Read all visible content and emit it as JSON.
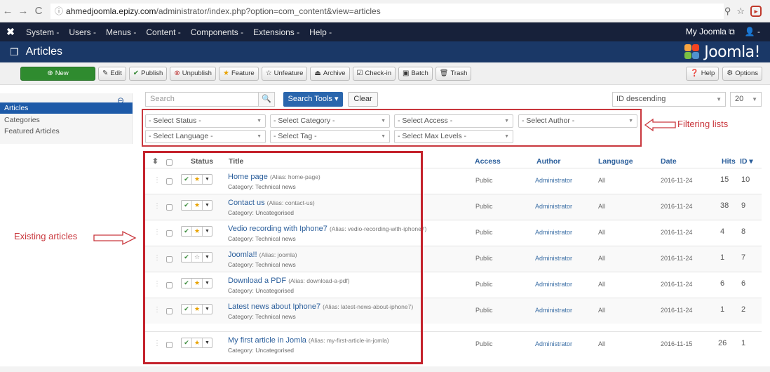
{
  "browser": {
    "url_prefix": "ahmedjoomla.epizy.com",
    "url_rest": "/administrator/index.php?option=com_content&view=articles",
    "info": "ⓘ"
  },
  "topnav": {
    "items": [
      "System -",
      "Users -",
      "Menus -",
      "Content -",
      "Components -",
      "Extensions -",
      "Help -"
    ],
    "my_joomla": "My Joomla ⧉",
    "user": "👤 -"
  },
  "header": {
    "title": "Articles",
    "brand": "Joomla!"
  },
  "toolbar": {
    "new": "New",
    "edit": "Edit",
    "publish": "Publish",
    "unpublish": "Unpublish",
    "feature": "Feature",
    "unfeature": "Unfeature",
    "archive": "Archive",
    "checkin": "Check-in",
    "batch": "Batch",
    "trash": "Trash",
    "help": "Help",
    "options": "Options"
  },
  "sidebar": {
    "items": [
      "Articles",
      "Categories",
      "Featured Articles"
    ]
  },
  "search": {
    "placeholder": "Search",
    "tools": "Search Tools ▾",
    "clear": "Clear",
    "ordering": "ID descending",
    "limit": "20"
  },
  "filters": {
    "status": "- Select Status -",
    "category": "- Select Category -",
    "access": "- Select Access -",
    "author": "- Select Author -",
    "language": "- Select Language -",
    "tag": "- Select Tag -",
    "max_levels": "- Select Max Levels -"
  },
  "annotations": {
    "filtering": "Filtering lists",
    "existing": "Existing articles"
  },
  "table": {
    "headers": {
      "order": "⬍",
      "status": "Status",
      "title": "Title",
      "access": "Access",
      "author": "Author",
      "language": "Language",
      "date": "Date",
      "hits": "Hits",
      "id": "ID ▾"
    },
    "rows": [
      {
        "title": "Home page",
        "alias": "(Alias: home-page)",
        "category": "Category: Technical news",
        "access": "Public",
        "author": "Administrator",
        "language": "All",
        "date": "2016-11-24",
        "hits": "15",
        "id": "10",
        "featured": "★"
      },
      {
        "title": "Contact us",
        "alias": "(Alias: contact-us)",
        "category": "Category: Uncategorised",
        "access": "Public",
        "author": "Administrator",
        "language": "All",
        "date": "2016-11-24",
        "hits": "38",
        "id": "9",
        "featured": "★"
      },
      {
        "title": "Vedio recording with Iphone7",
        "alias": "(Alias: vedio-recording-with-iphone7)",
        "category": "Category: Technical news",
        "access": "Public",
        "author": "Administrator",
        "language": "All",
        "date": "2016-11-24",
        "hits": "4",
        "id": "8",
        "featured": "★"
      },
      {
        "title": "Joomla!!",
        "alias": "(Alias: joomla)",
        "category": "Category: Technical news",
        "access": "Public",
        "author": "Administrator",
        "language": "All",
        "date": "2016-11-24",
        "hits": "1",
        "id": "7",
        "featured": "☆"
      },
      {
        "title": "Download a PDF",
        "alias": "(Alias: download-a-pdf)",
        "category": "Category: Uncategorised",
        "access": "Public",
        "author": "Administrator",
        "language": "All",
        "date": "2016-11-24",
        "hits": "6",
        "id": "6",
        "featured": "★"
      },
      {
        "title": "Latest news about Iphone7",
        "alias": "(Alias: latest-news-about-iphone7)",
        "category": "Category: Technical news",
        "access": "Public",
        "author": "Administrator",
        "language": "All",
        "date": "2016-11-24",
        "hits": "1",
        "id": "2",
        "featured": "★"
      },
      {
        "title": "My first article in Jomla",
        "alias": "(Alias: my-first-article-in-jomla)",
        "category": "Category: Uncategorised",
        "access": "Public",
        "author": "Administrator",
        "language": "All",
        "date": "2016-11-15",
        "hits": "26",
        "id": "1",
        "featured": "★"
      }
    ]
  }
}
